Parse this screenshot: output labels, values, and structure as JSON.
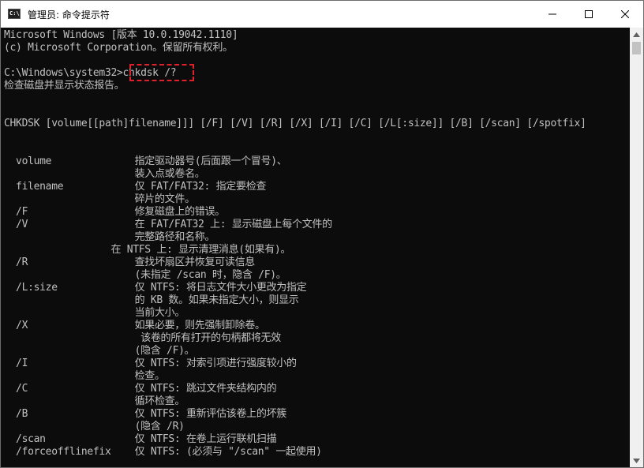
{
  "window": {
    "title": "管理员: 命令提示符",
    "icon_label": "C:\\"
  },
  "console": {
    "lines": [
      "Microsoft Windows [版本 10.0.19042.1110]",
      "(c) Microsoft Corporation。保留所有权利。",
      "",
      "C:\\Windows\\system32>chkdsk /?",
      "检查磁盘并显示状态报告。",
      "",
      "",
      "CHKDSK [volume[[path]filename]]] [/F] [/V] [/R] [/X] [/I] [/C] [/L[:size]] [/B] [/scan] [/spotfix]",
      "",
      "",
      "  volume              指定驱动器号(后面跟一个冒号)、",
      "                      装入点或卷名。",
      "  filename            仅 FAT/FAT32: 指定要检查",
      "                      碎片的文件。",
      "  /F                  修复磁盘上的错误。",
      "  /V                  在 FAT/FAT32 上: 显示磁盘上每个文件的",
      "                      完整路径和名称。",
      "                  在 NTFS 上: 显示清理消息(如果有)。",
      "  /R                  查找坏扇区并恢复可读信息",
      "                      (未指定 /scan 时，隐含 /F)。",
      "  /L:size             仅 NTFS: 将日志文件大小更改为指定",
      "                      的 KB 数。如果未指定大小，则显示",
      "                      当前大小。",
      "  /X                  如果必要，则先强制卸除卷。",
      "                       该卷的所有打开的句柄都将无效",
      "                      (隐含 /F)。",
      "  /I                  仅 NTFS: 对索引项进行强度较小的",
      "                      检查。",
      "  /C                  仅 NTFS: 跳过文件夹结构内的",
      "                      循环检查。",
      "  /B                  仅 NTFS: 重新评估该卷上的坏簇",
      "                      (隐含 /R)",
      "  /scan               仅 NTFS: 在卷上运行联机扫描",
      "  /forceofflinefix    仅 NTFS: (必须与 \"/scan\" 一起使用)"
    ]
  },
  "colors": {
    "console_bg": "#0c0c0c",
    "console_fg": "#c0c0c0",
    "highlight": "#e0202a"
  },
  "icons": {
    "minimize": "minimize-icon",
    "maximize": "maximize-icon",
    "close": "close-icon"
  }
}
